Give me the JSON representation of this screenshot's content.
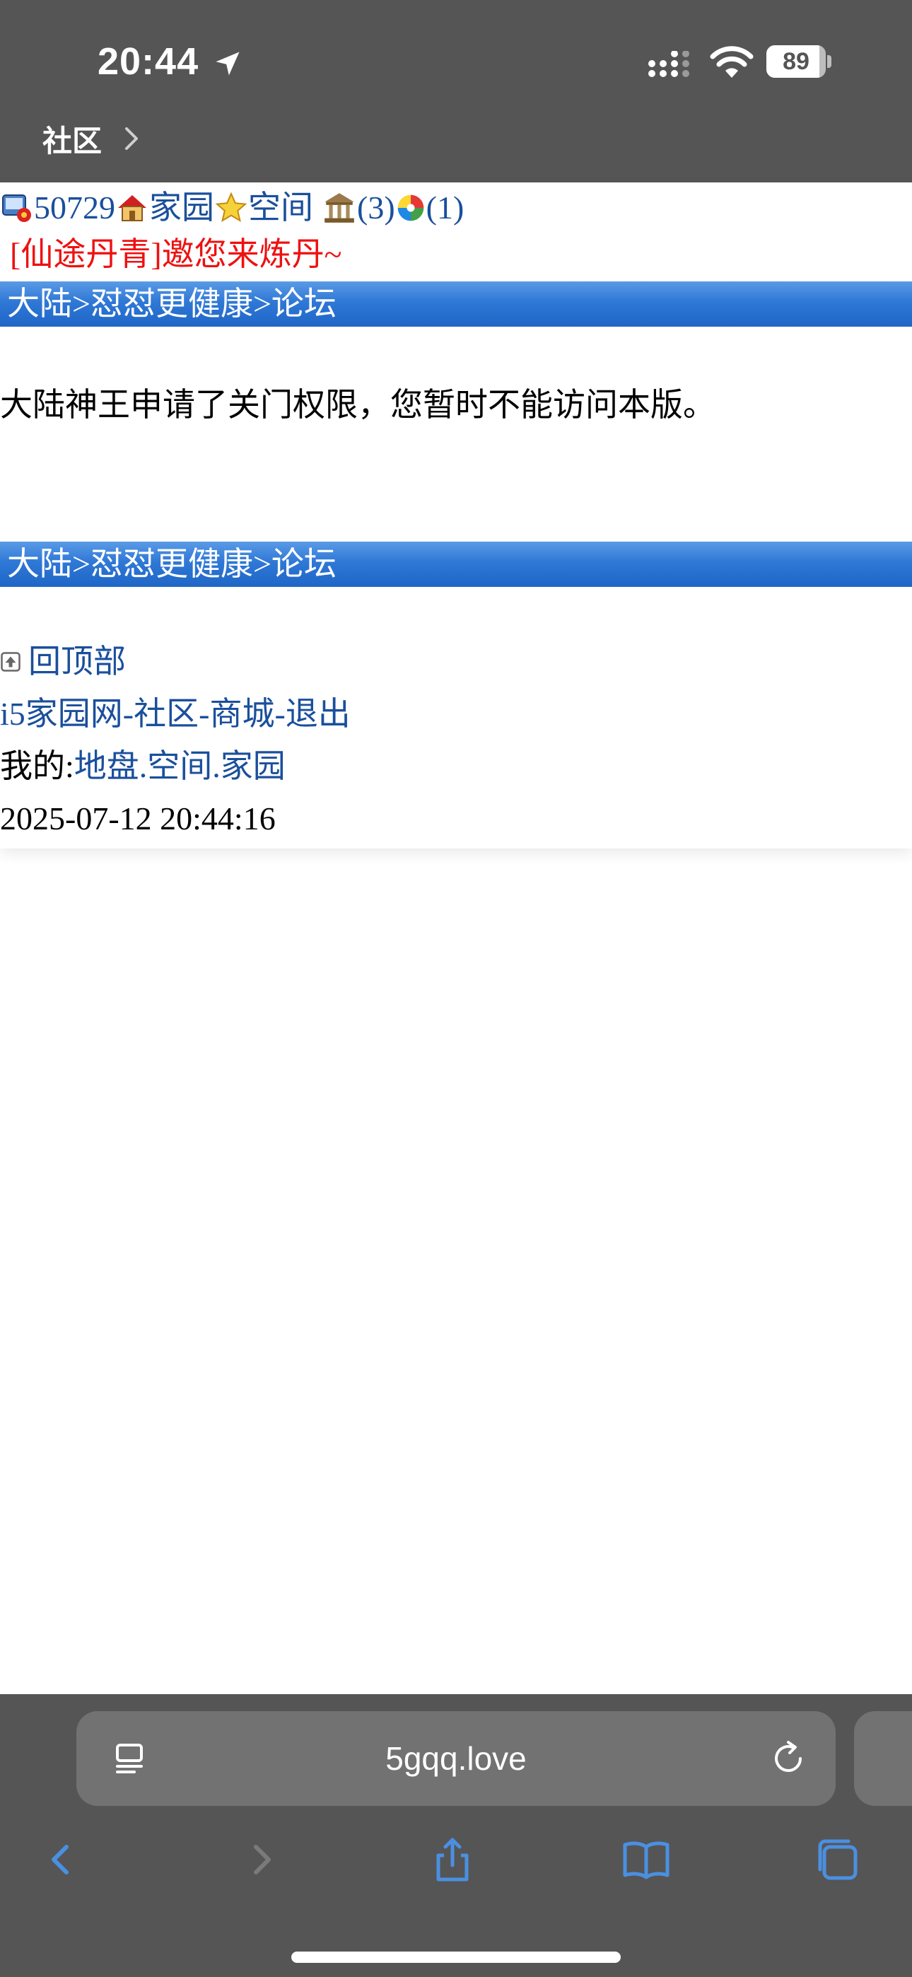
{
  "status_bar": {
    "time": "20:44",
    "battery_percent": "89",
    "battery_level": 0.89,
    "back_label": "社区"
  },
  "page": {
    "top_line": {
      "user_id": "50729",
      "home_link": "家园",
      "space_link": "空间",
      "count_one": "(3)",
      "count_two": "(1)"
    },
    "invite_text": "[仙途丹青]邀您来炼丹~",
    "breadcrumb": {
      "part1": "大陆",
      "sep": ">",
      "part2": "怼怼更健康",
      "part3": "论坛"
    },
    "message": "大陆神王申请了关门权限，您暂时不能访问本版。",
    "back_to_top": "回顶部",
    "footer_links": {
      "site": "i5家园网",
      "sep": "-",
      "community": "社区",
      "mall": "商城",
      "logout": "退出"
    },
    "mine": {
      "label": "我的:",
      "turf": "地盘",
      "dot": ".",
      "space": "空间",
      "home": "家园"
    },
    "datetime": "2025-07-12 20:44:16"
  },
  "safari": {
    "url": "5gqq.love"
  },
  "colors": {
    "link": "#1a4f9c",
    "invite": "#ee1111",
    "crumb_bar": "#2f78d6",
    "chrome": "#555555",
    "toolbar_icon": "#4a90e2"
  }
}
